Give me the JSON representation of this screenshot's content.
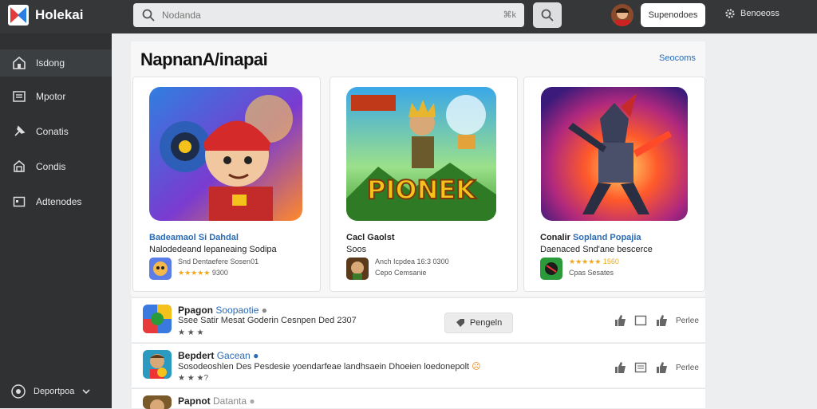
{
  "app": {
    "name": "Holekai"
  },
  "search": {
    "placeholder": "Nodanda",
    "shortcut": "⌘k"
  },
  "header": {
    "button_label": "Supenodoes",
    "settings_label": "Benoeoss"
  },
  "sidebar": {
    "items": [
      {
        "label": "Isdong",
        "icon": "home-icon"
      },
      {
        "label": "Mpotor",
        "icon": "list-icon"
      },
      {
        "label": "Conatis",
        "icon": "pin-icon"
      },
      {
        "label": "Condis",
        "icon": "store-icon"
      },
      {
        "label": "Adtenodes",
        "icon": "box-icon"
      }
    ],
    "footer_label": "Deportpoa"
  },
  "section": {
    "title": "NapnanA/inapai",
    "link": "Seocoms"
  },
  "cards": [
    {
      "title_plain": "",
      "title_blue": "Badeamaol Si Dahdal",
      "subtitle": "Nalodedeand lepaneaing Sodipa",
      "meta": "Snd Dentaefere Sosen01",
      "rating": "9300",
      "stars": "★★★★★"
    },
    {
      "title_plain": "Cacl Gaolst",
      "title_blue": "",
      "subtitle": "Soos",
      "meta": "Anch Icpdea 16:3 0300",
      "rating": "Cepo Cemsanie",
      "stars": ""
    },
    {
      "title_plain": "Conalir ",
      "title_blue": "Sopland Popajia",
      "subtitle": "Daenaced Snd'ane bescerce",
      "meta": "",
      "rating": "Cpas Sesates",
      "stars": "★★★★★ 1560"
    }
  ],
  "list": [
    {
      "title": "Ppagon",
      "tag": "Soopaotie",
      "desc": "Ssee Satir Mesat Goderin Cesnpen Ded 2307",
      "stars": "★ ★ ★",
      "button": "Pengeln",
      "action_label": "Perlee"
    },
    {
      "title": "Bepdert",
      "tag": "Gacean",
      "desc": "Sosodeoshlen Des Pesdesie yoendarfeae landhsaein Dhoeien loedonepolt",
      "stars": "★ ★ ★?",
      "button": "",
      "action_label": "Perlee"
    },
    {
      "title": "Papnot",
      "tag": "Datanta",
      "desc": "",
      "stars": "",
      "button": "",
      "action_label": ""
    }
  ],
  "colors": {
    "accent": "#2a6bb5",
    "topbar": "#353739",
    "sidebar": "#2f3133",
    "star": "#f0a81e"
  }
}
